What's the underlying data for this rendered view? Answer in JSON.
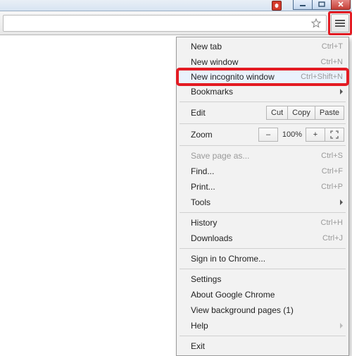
{
  "menu": {
    "new_tab": "New tab",
    "new_tab_sc": "Ctrl+T",
    "new_window": "New window",
    "new_window_sc": "Ctrl+N",
    "incognito": "New incognito window",
    "incognito_sc": "Ctrl+Shift+N",
    "bookmarks": "Bookmarks",
    "edit_label": "Edit",
    "cut": "Cut",
    "copy": "Copy",
    "paste": "Paste",
    "zoom_label": "Zoom",
    "zoom_minus": "–",
    "zoom_value": "100%",
    "zoom_plus": "+",
    "save_as": "Save page as...",
    "save_as_sc": "Ctrl+S",
    "find": "Find...",
    "find_sc": "Ctrl+F",
    "print": "Print...",
    "print_sc": "Ctrl+P",
    "tools": "Tools",
    "history": "History",
    "history_sc": "Ctrl+H",
    "downloads": "Downloads",
    "downloads_sc": "Ctrl+J",
    "signin": "Sign in to Chrome...",
    "settings": "Settings",
    "about": "About Google Chrome",
    "bg_pages": "View background pages (1)",
    "help": "Help",
    "exit": "Exit"
  }
}
